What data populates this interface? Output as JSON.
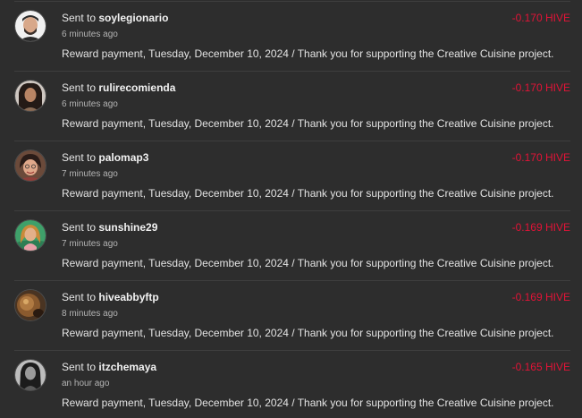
{
  "sent_prefix": "Sent to",
  "currency": "HIVE",
  "colors": {
    "background": "#2d2d2d",
    "divider": "#3e3e3e",
    "amount": "#e31337",
    "text": "#e6e6e6",
    "muted": "#b4b4b4"
  },
  "transactions": [
    {
      "user": "soylegionario",
      "time": "6 minutes ago",
      "amount": "-0.170 HIVE",
      "memo": "Reward payment, Tuesday, December 10, 2024 / Thank you for supporting the Creative Cuisine project.",
      "avatar": "user-avatar-soylegionario"
    },
    {
      "user": "rulirecomienda",
      "time": "6 minutes ago",
      "amount": "-0.170 HIVE",
      "memo": "Reward payment, Tuesday, December 10, 2024 / Thank you for supporting the Creative Cuisine project.",
      "avatar": "user-avatar-rulirecomienda"
    },
    {
      "user": "palomap3",
      "time": "7 minutes ago",
      "amount": "-0.170 HIVE",
      "memo": "Reward payment, Tuesday, December 10, 2024 / Thank you for supporting the Creative Cuisine project.",
      "avatar": "user-avatar-palomap3"
    },
    {
      "user": "sunshine29",
      "time": "7 minutes ago",
      "amount": "-0.169 HIVE",
      "memo": "Reward payment, Tuesday, December 10, 2024 / Thank you for supporting the Creative Cuisine project.",
      "avatar": "user-avatar-sunshine29"
    },
    {
      "user": "hiveabbyftp",
      "time": "8 minutes ago",
      "amount": "-0.169 HIVE",
      "memo": "Reward payment, Tuesday, December 10, 2024 / Thank you for supporting the Creative Cuisine project.",
      "avatar": "user-avatar-hiveabbyftp"
    },
    {
      "user": "itzchemaya",
      "time": "an hour ago",
      "amount": "-0.165 HIVE",
      "memo": "Reward payment, Tuesday, December 10, 2024 / Thank you for supporting the Creative Cuisine project.",
      "avatar": "user-avatar-itzchemaya"
    }
  ]
}
